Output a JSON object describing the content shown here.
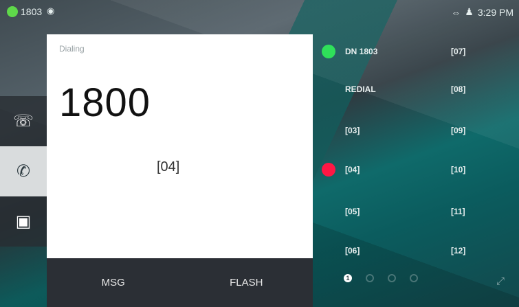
{
  "status_bar": {
    "extension": "1803",
    "ext_icon": "chat-bubble-icon",
    "time": "3:29 PM",
    "icons": [
      "ethernet-icon",
      "headset-icon"
    ]
  },
  "sidebar": {
    "items": [
      {
        "icon": "call-log-icon",
        "glyph": "☏"
      },
      {
        "icon": "phone-icon",
        "glyph": "✆"
      },
      {
        "icon": "contacts-icon",
        "glyph": "▣"
      }
    ]
  },
  "dialing": {
    "status": "Dialing",
    "number": "1800",
    "line": "[04]"
  },
  "softkeys": [
    "MSG",
    "FLASH"
  ],
  "line_keys": [
    {
      "label": "DN 1803",
      "state": "green"
    },
    {
      "label": "REDIAL",
      "state": "none"
    },
    {
      "label": "[03]",
      "state": "none"
    },
    {
      "label": "[04]",
      "state": "red"
    },
    {
      "label": "[05]",
      "state": "none"
    },
    {
      "label": "[06]",
      "state": "none"
    },
    {
      "label": "[07]",
      "state": "none"
    },
    {
      "label": "[08]",
      "state": "none"
    },
    {
      "label": "[09]",
      "state": "none"
    },
    {
      "label": "[10]",
      "state": "none"
    },
    {
      "label": "[11]",
      "state": "none"
    },
    {
      "label": "[12]",
      "state": "none"
    }
  ],
  "pager": {
    "current": "1",
    "total": 4
  },
  "colors": {
    "accent_green": "#2fe05a",
    "accent_red": "#ff1744",
    "teal": "#0f6a6a"
  }
}
